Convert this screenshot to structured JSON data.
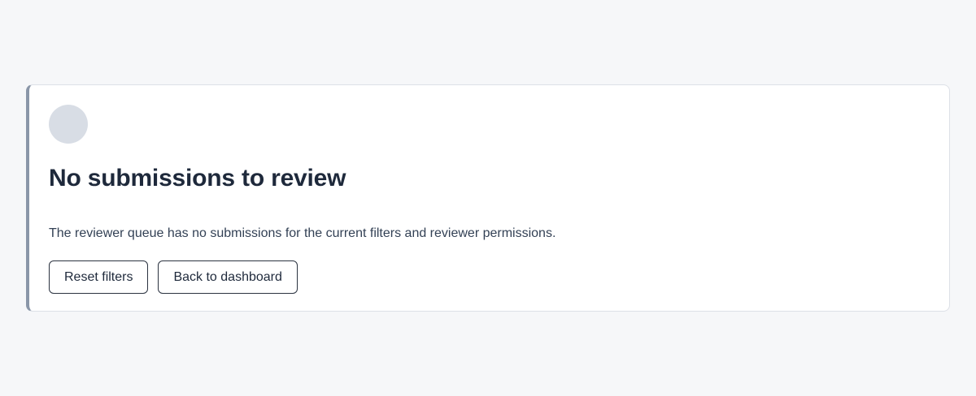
{
  "empty_state": {
    "title": "No submissions to review",
    "description": "The reviewer queue has no submissions for the current filters and reviewer permissions.",
    "actions": {
      "reset_label": "Reset filters",
      "back_label": "Back to dashboard"
    }
  },
  "colors": {
    "page_background": "#f6f7f9",
    "card_background": "#ffffff",
    "accent_border": "#8a96a8",
    "placeholder": "#d8dde5",
    "text": "#1e293b"
  }
}
